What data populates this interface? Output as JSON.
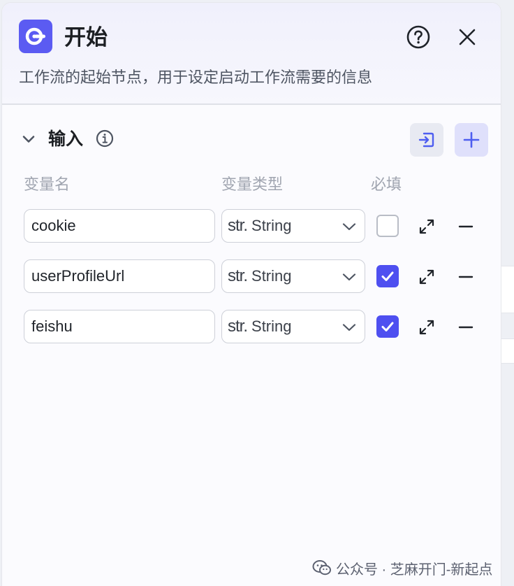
{
  "node": {
    "title": "开始",
    "description": "工作流的起始节点，用于设定启动工作流需要的信息",
    "accent_color": "#5b5bf2",
    "icon": "start-node-icon"
  },
  "header_actions": {
    "help_icon": "question-circle-icon",
    "close_icon": "close-icon"
  },
  "input_section": {
    "title": "输入",
    "columns": {
      "name": "变量名",
      "type": "变量类型",
      "required": "必填"
    },
    "variables": [
      {
        "name": "cookie",
        "type_prefix": "str.",
        "type": "String",
        "required": false
      },
      {
        "name": "userProfileUrl",
        "type_prefix": "str.",
        "type": "String",
        "required": true
      },
      {
        "name": "feishu",
        "type_prefix": "str.",
        "type": "String",
        "required": true
      }
    ]
  },
  "watermark": {
    "text": "公众号 · 芝麻开门-新起点"
  }
}
